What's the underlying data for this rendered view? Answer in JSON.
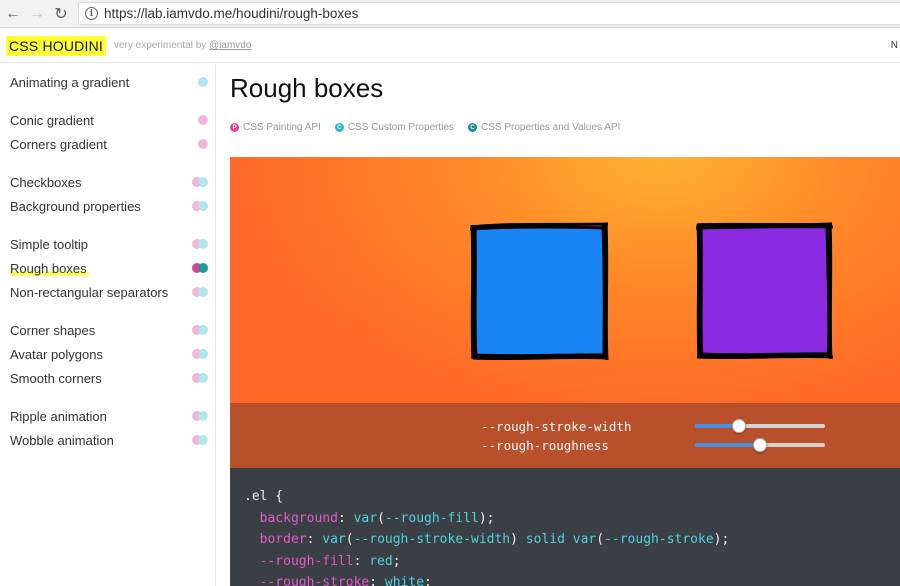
{
  "browser": {
    "url": "https://lab.iamvdo.me/houdini/rough-boxes",
    "back_glyph": "←",
    "forward_glyph": "→",
    "reload_glyph": "↻",
    "info_glyph": "i"
  },
  "header": {
    "logo": "CSS HOUDINI",
    "tagline_prefix": "very experimental by ",
    "tagline_author": "@iamvdo",
    "right_text": "N"
  },
  "sidebar": {
    "items": [
      {
        "label": "Animating a gradient",
        "dots": [
          "cyan"
        ]
      },
      {
        "label": "Conic gradient",
        "dots": [
          "pink"
        ]
      },
      {
        "label": "Corners gradient",
        "dots": [
          "pink"
        ]
      },
      {
        "label": "Checkboxes",
        "dots": [
          "pink",
          "cyan"
        ]
      },
      {
        "label": "Background properties",
        "dots": [
          "pink",
          "cyan"
        ]
      },
      {
        "label": "Simple tooltip",
        "dots": [
          "pink",
          "cyan"
        ]
      },
      {
        "label": "Rough boxes",
        "dots": [
          "pink",
          "teal"
        ],
        "active": true
      },
      {
        "label": "Non-rectangular separators",
        "dots": [
          "pink",
          "cyan"
        ]
      },
      {
        "label": "Corner shapes",
        "dots": [
          "pink",
          "cyan"
        ]
      },
      {
        "label": "Avatar polygons",
        "dots": [
          "pink",
          "cyan"
        ]
      },
      {
        "label": "Smooth corners",
        "dots": [
          "pink",
          "cyan"
        ]
      },
      {
        "label": "Ripple animation",
        "dots": [
          "pink",
          "cyan"
        ]
      },
      {
        "label": "Wobble animation",
        "dots": [
          "pink",
          "cyan"
        ]
      }
    ]
  },
  "main": {
    "title": "Rough boxes",
    "tags": [
      {
        "letter": "P",
        "label": "CSS Painting API",
        "color": "#e0418e"
      },
      {
        "letter": "C",
        "label": "CSS Custom Properties",
        "color": "#1fb8c8"
      },
      {
        "letter": "C",
        "label": "CSS Properties and Values API",
        "color": "#1a8a8a"
      }
    ],
    "demo": {
      "box1_fill": "#1a86f6",
      "box2_fill": "#8a2be2"
    },
    "controls": {
      "stroke_width_label": "--rough-stroke-width",
      "roughness_label": "--rough-roughness",
      "stroke_width_fraction": 0.34,
      "roughness_fraction": 0.5
    },
    "code": {
      "line1_selector": ".el {",
      "line2_prop": "background",
      "line2_fn": "var",
      "line2_var": "--rough-fill",
      "line3_prop": "border",
      "line3_var1": "--rough-stroke-width",
      "line3_mid": "solid",
      "line3_var2": "--rough-stroke",
      "line4_prop": "--rough-fill",
      "line4_val": "red",
      "line5_prop": "--rough-stroke",
      "line5_val": "white"
    }
  }
}
